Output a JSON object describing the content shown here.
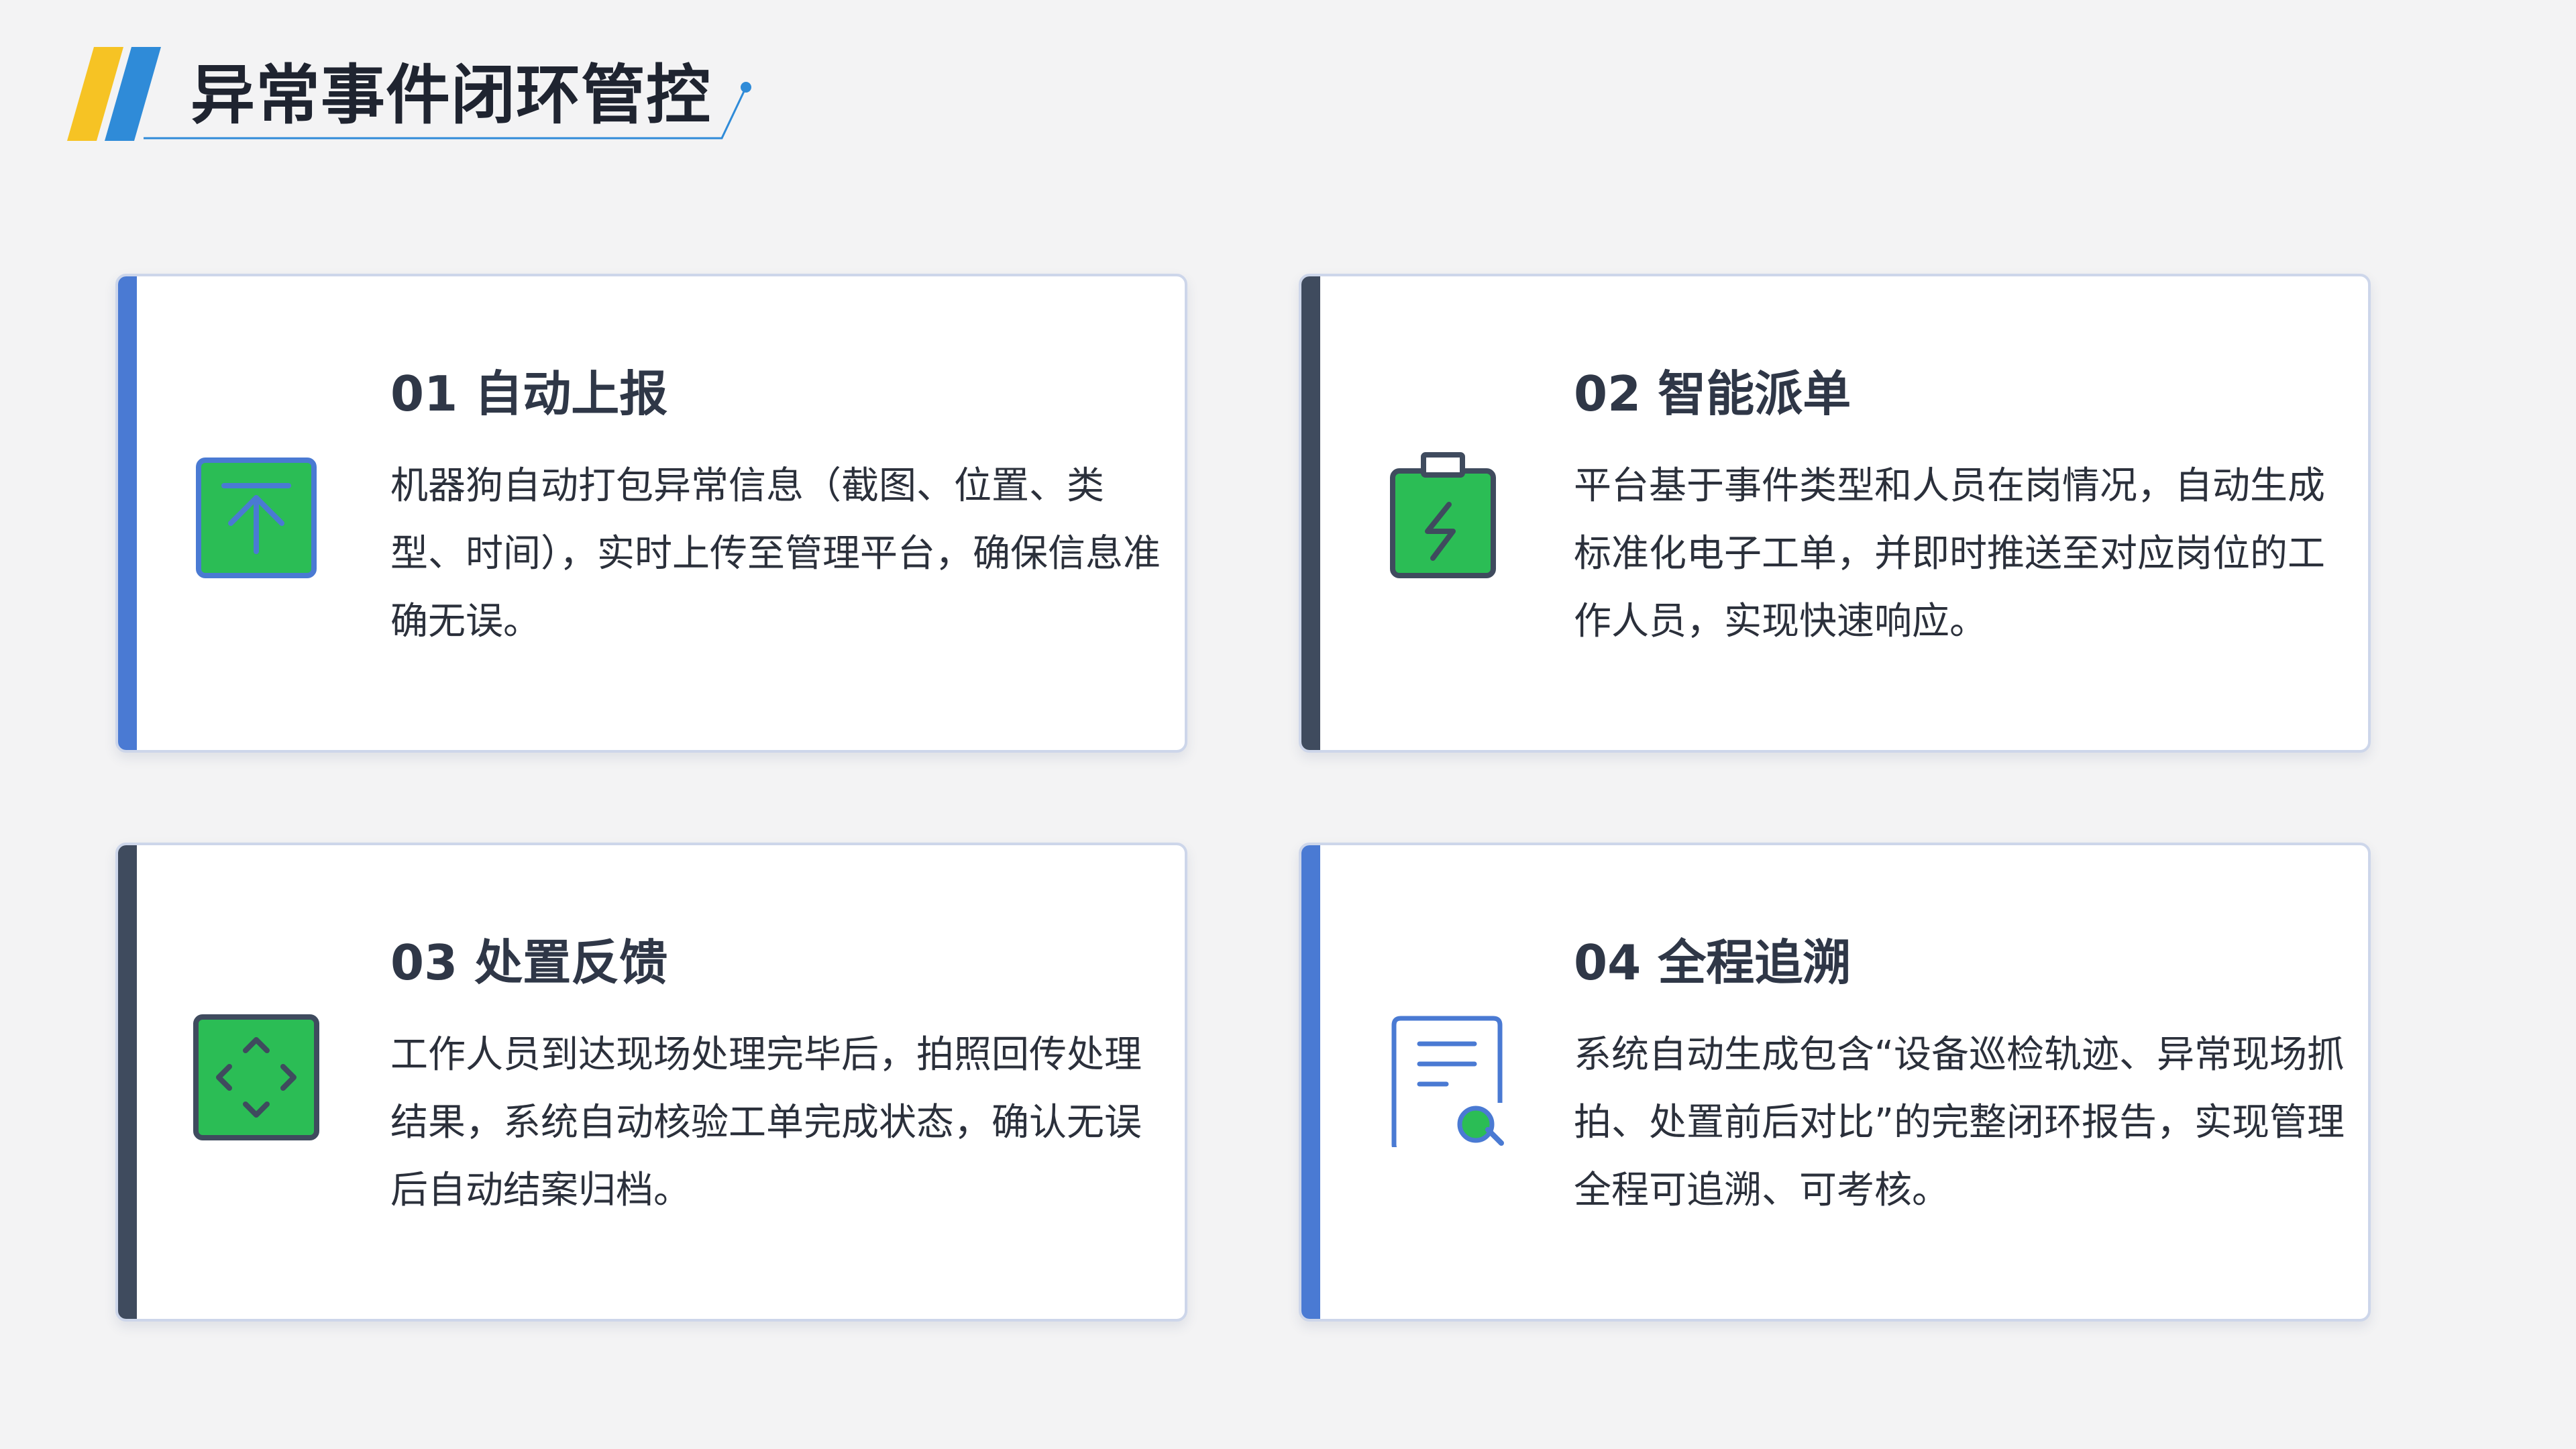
{
  "header": {
    "title": "异常事件闭环管控"
  },
  "colors": {
    "accent_blue": "#4a7ad3",
    "accent_dark": "#3f4b5e",
    "icon_green": "#2bbd55",
    "logo_yellow": "#f6c324",
    "logo_blue": "#2f8bd8"
  },
  "cards": [
    {
      "title": "01 自动上报",
      "description": "机器狗自动打包异常信息（截图、位置、类型、时间），实时上传至管理平台，确保信息准确无误。",
      "icon": "upload-icon"
    },
    {
      "title": "02 智能派单",
      "description": "平台基于事件类型和人员在岗情况，自动生成标准化电子工单，并即时推送至对应岗位的工作人员，实现快速响应。",
      "icon": "clipboard-lightning-icon"
    },
    {
      "title": "03 处置反馈",
      "description": "工作人员到达现场处理完毕后，拍照回传处理结果，系统自动核验工单完成状态，确认无误后自动结案归档。",
      "icon": "expand-arrows-icon"
    },
    {
      "title": "04 全程追溯",
      "description": "系统自动生成包含“设备巡检轨迹、异常现场抓拍、处置前后对比”的完整闭环报告，实现管理全程可追溯、可考核。",
      "icon": "document-search-icon"
    }
  ]
}
